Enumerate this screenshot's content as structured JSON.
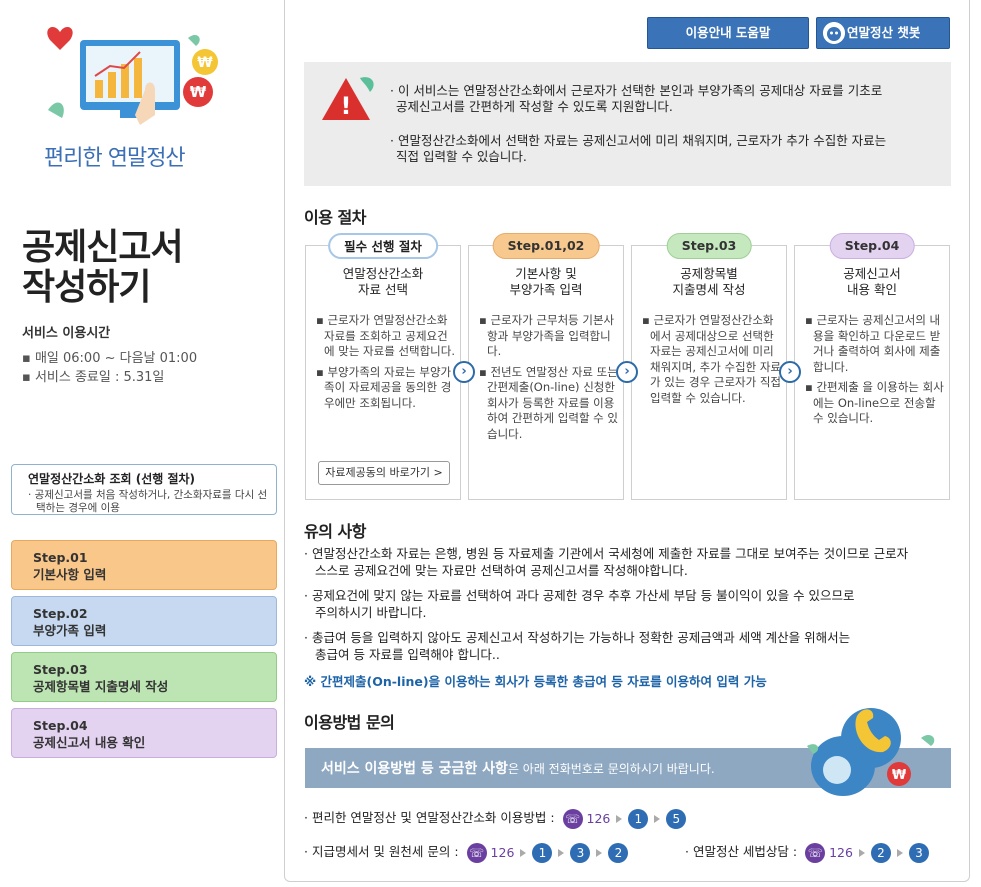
{
  "sidebar": {
    "brand": "편리한 연말정산",
    "title_line1": "공제신고서",
    "title_line2": "작성하기",
    "service_time_label": "서비스 이용시간",
    "service_time_1": "▪ 매일 06:00 ~ 다음날 01:00",
    "service_time_2": "▪ 서비스 종료일 : 5.31일",
    "pre_step": {
      "title": "연말정산간소화 조회 (선행 절차)",
      "desc": "· 공제신고서를 처음 작성하거나, 간소화자료를 다시 선택하는 경우에 이용"
    },
    "steps": [
      {
        "step": "Step.01",
        "label": "기본사항 입력"
      },
      {
        "step": "Step.02",
        "label": "부양가족 입력"
      },
      {
        "step": "Step.03",
        "label": "공제항목별 지출명세 작성"
      },
      {
        "step": "Step.04",
        "label": "공제신고서 내용 확인"
      }
    ]
  },
  "header": {
    "help_label": "이용안내 도움말",
    "chatbot_label": "연말정산 챗봇"
  },
  "notice": {
    "item1_line1": "· 이 서비스는 연말정산간소화에서 근로자가 선택한 본인과 부양가족의 공제대상 자료를 기초로",
    "item1_line2": "공제신고서를 간편하게 작성할 수 있도록 지원합니다.",
    "item2_line1": "· 연말정산간소화에서 선택한 자료는 공제신고서에 미리 채워지며, 근로자가 추가 수집한 자료는",
    "item2_line2": "직접 입력할 수 있습니다."
  },
  "procedure": {
    "title": "이용 절차",
    "cards": [
      {
        "pill": "필수 선행 절차",
        "title1": "연말정산간소화",
        "title2": "자료 선택",
        "items": [
          "▪ 근로자가 연말정산간소화 자료를 조회하고 공제요건에 맞는 자료를 선택합니다.",
          "▪ 부양가족의 자료는 부양가족이 자료제공을 동의한 경우에만 조회됩니다."
        ],
        "button": "자료제공동의 바로가기 >"
      },
      {
        "pill": "Step.01,02",
        "title1": "기본사항 및",
        "title2": "부양가족 입력",
        "items": [
          "▪ 근로자가 근무처등 기본사항과 부양가족을 입력합니다.",
          "▪ 전년도 연말정산 자료 또는 간편제출(On-line) 신청한 회사가 등록한 자료를 이용하여 간편하게 입력할 수 있습니다."
        ]
      },
      {
        "pill": "Step.03",
        "title1": "공제항목별",
        "title2": "지출명세  작성",
        "items": [
          "▪ 근로자가 연말정산간소화에서 공제대상으로 선택한 자료는 공제신고서에 미리 채워지며, 추가 수집한 자료가 있는 경우 근로자가 직접 입력할 수 있습니다."
        ]
      },
      {
        "pill": "Step.04",
        "title1": "공제신고서",
        "title2": "내용 확인",
        "items": [
          "▪ 근로자는 공제신고서의 내용을 확인하고 다운로드 받거나 출력하여 회사에 제출합니다.",
          "▪ 간편제출 을 이용하는 회사에는 On-line으로 전송할 수 있습니다."
        ]
      }
    ]
  },
  "caution": {
    "title": "유의 사항",
    "c1_line1": "· 연말정산간소화 자료는 은행, 병원 등 자료제출 기관에서 국세청에 제출한 자료를 그대로 보여주는 것이므로 근로자",
    "c1_line2": "스스로 공제요건에 맞는 자료만 선택하여 공제신고서를 작성해야합니다.",
    "c2_line1": "· 공제요건에 맞지 않는 자료를 선택하여 과다 공제한 경우 추후 가산세 부담 등 불이익이 있을 수 있으므로",
    "c2_line2": "주의하시기 바랍니다.",
    "c3_line1": "· 총급여 등을 입력하지 않아도 공제신고서 작성하기는 가능하나 정확한 공제금액과 세액 계산을 위해서는",
    "c3_line2": "총급여 등 자료를 입력해야 합니다..",
    "note": "※ 간편제출(On-line)을 이용하는 회사가 등록한 총급여 등 자료를 이용하여 입력 가능"
  },
  "inquiry": {
    "title": "이용방법 문의",
    "banner_bold": "서비스 이용방법 등 궁금한 사항",
    "banner_rest": "은 아래 전화번호로 문의하시기 바랍니다.",
    "row1_label": "· 편리한 연말정산 및 연말정산간소화 이용방법 :",
    "row1_numbers": [
      "1",
      "5"
    ],
    "row2_label": "· 지급명세서  및 원천세 문의 :",
    "row2_numbers": [
      "1",
      "3",
      "2"
    ],
    "row3_label": "· 연말정산 세법상담  :",
    "row3_numbers": [
      "2",
      "3"
    ],
    "phone_main": "126"
  },
  "colors": {
    "primary_button": "#3a73b8",
    "step1": "#fac78a",
    "step2": "#c6d9f0",
    "step3": "#bde5b3",
    "step4": "#e3d2f0",
    "phone_purple": "#6a3fa0",
    "number_blue": "#2e6db3"
  }
}
